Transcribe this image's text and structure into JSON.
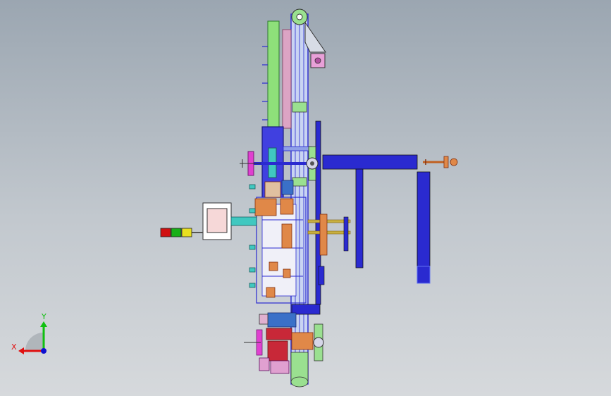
{
  "view": {
    "background_top": "#9ba6b1",
    "background_bottom": "#d6d9dc"
  },
  "triad": {
    "x_label": "X",
    "y_label": "Y",
    "x_color": "#e01010",
    "y_color": "#10c010",
    "z_color": "#1010d0"
  },
  "stack_light": {
    "colors": [
      "#d01010",
      "#18b018",
      "#e8e020"
    ]
  },
  "palette": {
    "frame_blue": "#2a2ad0",
    "rail_blue": "#8fa0e8",
    "green_part": "#8ee07a",
    "pink_part": "#d8a0c8",
    "orange_part": "#e08848",
    "magenta_part": "#e040d0",
    "cyan_part": "#40c8c0",
    "gray_part": "#c8c8c8"
  }
}
